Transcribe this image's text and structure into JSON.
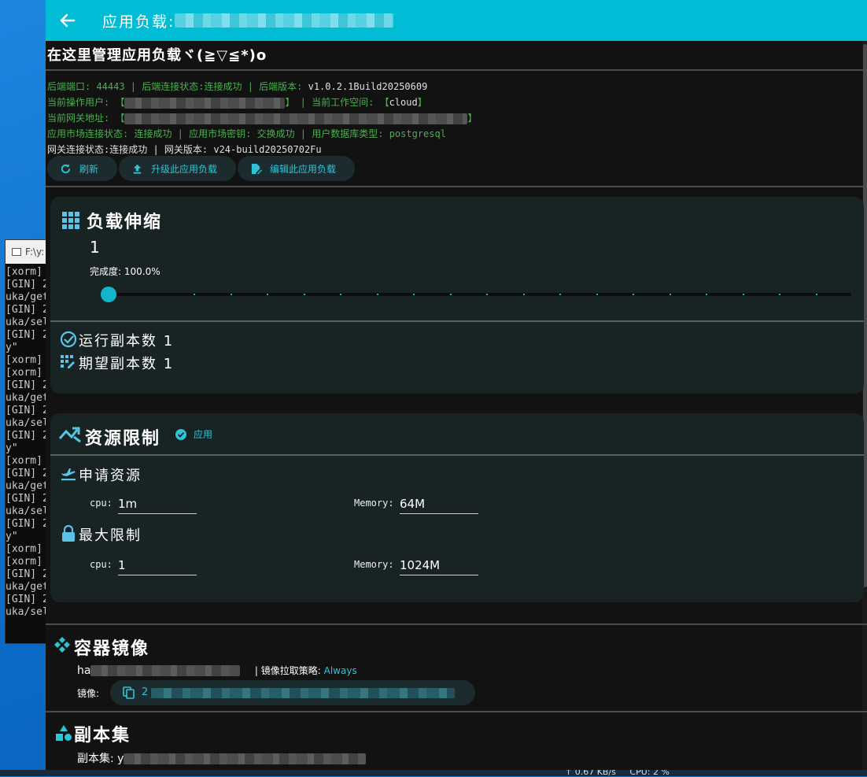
{
  "desktop": {
    "console": {
      "title": "F:\\y:",
      "lines": [
        "[xorm]",
        "[GIN] 2",
        "uka/get",
        "[GIN] 2",
        "uka/sel",
        "[GIN] 2",
        "y\"",
        "[xorm]",
        "[xorm]",
        "[GIN] 2",
        "uka/get",
        "[GIN] 2",
        "uka/sel",
        "[GIN] 2",
        "y\"",
        "[xorm]",
        "[GIN] 2",
        "uka/get",
        "[GIN] 2",
        "uka/sel",
        "[GIN] 2",
        "y\"",
        "[xorm]",
        "[xorm]",
        "[GIN] 2",
        "uka/get",
        "[GIN] 2",
        "uka/sel"
      ]
    },
    "tray": "↑ 0.67 KB/s     CPU: 2 %"
  },
  "appbar": {
    "title": "应用负载: "
  },
  "page": {
    "heading": "在这里管理应用负载ヾ(≧▽≦*)o",
    "info": {
      "row1": "后端端口: 44443 | 后端连接状态:连接成功 | 后端版本: ",
      "row1_version": "v1.0.2.1Build20250609",
      "row2_prefix": "当前操作用户: 【",
      "row2_mid": "】 | 当前工作空间: 【",
      "row2_workspace": "cloud",
      "row2_suffix": "】",
      "row3_prefix": "当前网关地址: 【",
      "row3_suffix": "】",
      "row4": "应用市场连接状态: 连接成功 | 应用市场密钥: 交换成功 | 用户数据库类型: postgresql",
      "row5_prefix": "网关连接状态:连接成功 | 网关版本: ",
      "row5_version": "v24-build20250702Fu"
    },
    "buttons": {
      "refresh": "刷新",
      "upgrade": "升级此应用负载",
      "edit": "编辑此应用负载"
    }
  },
  "scaling": {
    "title": "负载伸缩",
    "value": "1",
    "progress_label": "完成度: 100.0%",
    "progress": 1.0,
    "running_label": "运行副本数 1",
    "desired_label": "期望副本数 1"
  },
  "resources": {
    "title": "资源限制",
    "apply_label": "应用",
    "requests_title": "申请资源",
    "limits_title": "最大限制",
    "cpu_label": "cpu:",
    "memory_label": "Memory:",
    "requests": {
      "cpu": "1m",
      "memory": "64M"
    },
    "limits": {
      "cpu": "1",
      "memory": "1024M"
    }
  },
  "container": {
    "title": "容器镜像",
    "name_prefix": "ha",
    "pull_policy_label": "| 镜像拉取策略: ",
    "pull_policy": "Always",
    "image_label": "镜像:",
    "image_prefix": "2"
  },
  "replicaset": {
    "title": "副本集",
    "label": "副本集: y"
  },
  "colors": {
    "accent": "#00bcd4",
    "ok": "#4caf50",
    "card": "#182424",
    "background": "#121212"
  }
}
